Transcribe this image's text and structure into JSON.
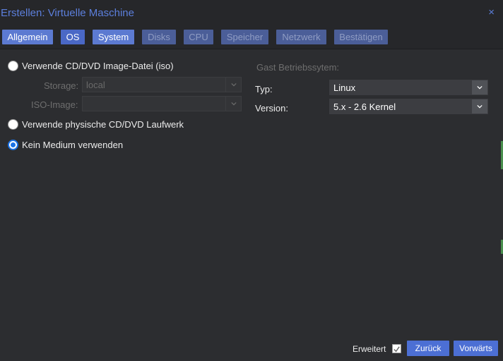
{
  "window": {
    "title": "Erstellen: Virtuelle Maschine",
    "close_glyph": "×"
  },
  "tabs": [
    {
      "label": "Allgemein",
      "state": "enabled"
    },
    {
      "label": "OS",
      "state": "active"
    },
    {
      "label": "System",
      "state": "enabled"
    },
    {
      "label": "Disks",
      "state": "disabled"
    },
    {
      "label": "CPU",
      "state": "disabled"
    },
    {
      "label": "Speicher",
      "state": "disabled"
    },
    {
      "label": "Netzwerk",
      "state": "disabled"
    },
    {
      "label": "Bestätigen",
      "state": "disabled"
    }
  ],
  "media": {
    "iso_option": "Verwende CD/DVD Image-Datei (iso)",
    "storage_label": "Storage:",
    "storage_value": "local",
    "iso_image_label": "ISO-Image:",
    "iso_image_value": "",
    "physical_option": "Verwende physische CD/DVD Laufwerk",
    "none_option": "Kein Medium verwenden",
    "selected": "none"
  },
  "guest": {
    "heading": "Gast Betriebssytem:",
    "type_label": "Typ:",
    "type_value": "Linux",
    "version_label": "Version:",
    "version_value": "5.x - 2.6 Kernel"
  },
  "footer": {
    "advanced_label": "Erweitert",
    "advanced_checked": true,
    "back_label": "Zurück",
    "next_label": "Vorwärts"
  },
  "icons": {
    "close": "close-icon",
    "dropdown": "chevron-down-icon",
    "checkmark": "checkmark-icon"
  },
  "colors": {
    "accent": "#5c7fdc",
    "tab_enabled": "#5c7ad1",
    "tab_active": "#4a68c6",
    "tab_disabled": "#4b5e98",
    "button": "#4c6fd4",
    "radio_selected": "#1a73e8",
    "background": "#2c2d30"
  }
}
